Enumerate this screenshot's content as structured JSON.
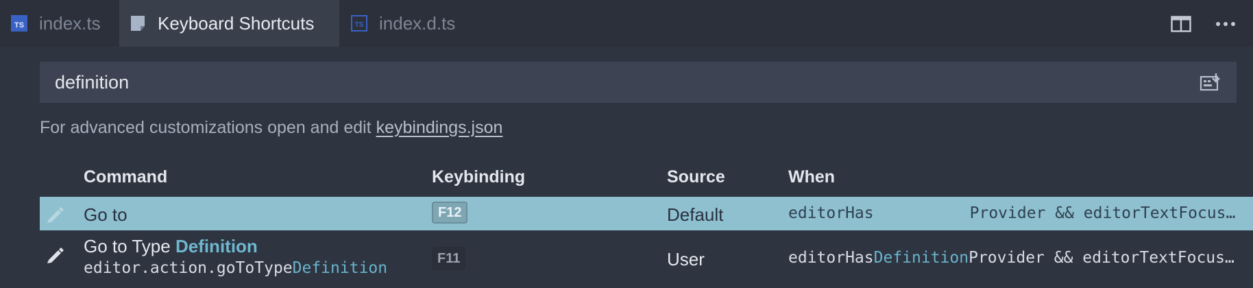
{
  "tabs": [
    {
      "label": "index.ts",
      "icon": "typescript-file-icon",
      "active": false
    },
    {
      "label": "Keyboard Shortcuts",
      "icon": "keyboard-shortcuts-file-icon",
      "active": true
    },
    {
      "label": "index.d.ts",
      "icon": "typescript-definition-file-icon",
      "active": false
    }
  ],
  "tab_badges": {
    "ts": "TS"
  },
  "tab_actions": [
    "split-editor-icon",
    "more-actions-icon"
  ],
  "search": {
    "value": "definition",
    "record_keys_icon": "record-keys-icon"
  },
  "hint": {
    "text": "For advanced customizations open and edit ",
    "link": "keybindings.json"
  },
  "columns": {
    "command": "Command",
    "keybinding": "Keybinding",
    "source": "Source",
    "when": "When"
  },
  "rows": [
    {
      "selected": true,
      "title_pre": "Go to",
      "title_hl": "",
      "command_id_pre": "",
      "command_id_hl": "",
      "key": "F12",
      "source": "Default",
      "when_pre": "editorHas",
      "when_hl": "",
      "when_post": "Provider && editorTextFocus…"
    },
    {
      "selected": false,
      "title_pre": "Go to Type ",
      "title_hl": "Definition",
      "command_id_pre": "editor.action.goToType",
      "command_id_hl": "Definition",
      "key": "F11",
      "source": "User",
      "when_pre": "editorHas",
      "when_hl": "Definition",
      "when_post": "Provider && editorTextFocus…"
    }
  ],
  "colors": {
    "background": "#2f3441",
    "tabbar": "#2b303b",
    "active_tab": "#3a3f4c",
    "selected_row": "#8ec0cf",
    "highlight": "#6fb8cf"
  }
}
